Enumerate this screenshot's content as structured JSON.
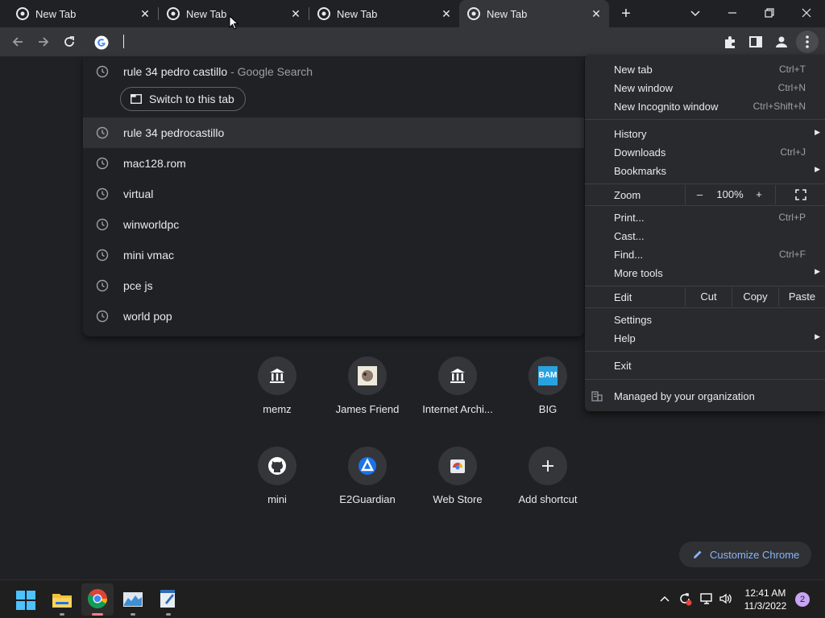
{
  "tabs": [
    {
      "title": "New Tab",
      "active": false
    },
    {
      "title": "New Tab",
      "active": false
    },
    {
      "title": "New Tab",
      "active": false
    },
    {
      "title": "New Tab",
      "active": true
    }
  ],
  "omnibox": {
    "value": ""
  },
  "suggestions": [
    {
      "text": "rule 34 pedro castillo",
      "suffix": " - Google Search",
      "switch_label": "Switch to this tab"
    },
    {
      "text": "rule 34 pedrocastillo",
      "highlighted": true
    },
    {
      "text": "mac128.rom"
    },
    {
      "text": "virtual"
    },
    {
      "text": "winworldpc"
    },
    {
      "text": "mini vmac"
    },
    {
      "text": "pce js"
    },
    {
      "text": "world pop"
    }
  ],
  "shortcuts": [
    {
      "label": "memz",
      "icon": "archive-icon"
    },
    {
      "label": "James Friend",
      "icon": "avatar-icon"
    },
    {
      "label": "Internet Archi...",
      "icon": "archive-icon"
    },
    {
      "label": "BIG",
      "icon": "bam-icon",
      "icon_text": "BAM"
    },
    {
      "label": "mini",
      "icon": "github-icon"
    },
    {
      "label": "E2Guardian",
      "icon": "e2guardian-icon"
    },
    {
      "label": "Web Store",
      "icon": "webstore-icon"
    },
    {
      "label": "Add shortcut",
      "icon": "plus-icon"
    }
  ],
  "customize": {
    "label": "Customize Chrome"
  },
  "menu": {
    "new_tab": {
      "label": "New tab",
      "shortcut": "Ctrl+T"
    },
    "new_window": {
      "label": "New window",
      "shortcut": "Ctrl+N"
    },
    "new_incognito": {
      "label": "New Incognito window",
      "shortcut": "Ctrl+Shift+N"
    },
    "history": {
      "label": "History"
    },
    "downloads": {
      "label": "Downloads",
      "shortcut": "Ctrl+J"
    },
    "bookmarks": {
      "label": "Bookmarks"
    },
    "zoom": {
      "label": "Zoom",
      "minus": "–",
      "value": "100%",
      "plus": "+"
    },
    "print": {
      "label": "Print...",
      "shortcut": "Ctrl+P"
    },
    "cast": {
      "label": "Cast..."
    },
    "find": {
      "label": "Find...",
      "shortcut": "Ctrl+F"
    },
    "more_tools": {
      "label": "More tools"
    },
    "edit": {
      "label": "Edit",
      "cut": "Cut",
      "copy": "Copy",
      "paste": "Paste"
    },
    "settings": {
      "label": "Settings"
    },
    "help": {
      "label": "Help"
    },
    "exit": {
      "label": "Exit"
    },
    "managed": {
      "label": "Managed by your organization"
    }
  },
  "taskbar": {
    "time": "12:41 AM",
    "date": "11/3/2022",
    "notifications": "2"
  },
  "colors": {
    "accent": "#8ab4f8",
    "background": "#202124",
    "menu": "#292a2d"
  }
}
